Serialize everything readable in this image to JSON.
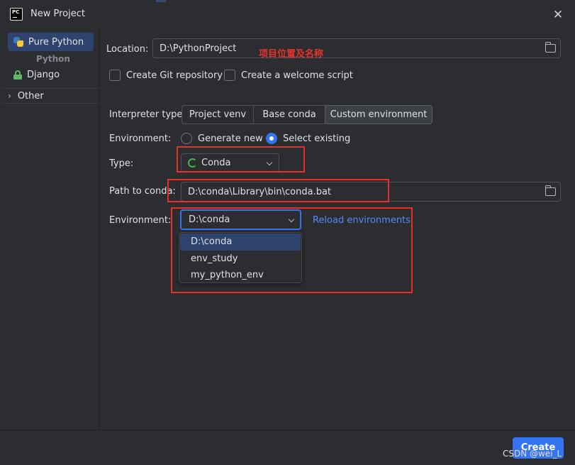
{
  "window": {
    "title": "New Project",
    "app_icon_text": "PC"
  },
  "sidebar": {
    "items": [
      {
        "label": "Pure Python",
        "icon": "python-icon"
      },
      {
        "label": "Django",
        "icon": "lock-icon"
      }
    ],
    "group_label": "Python",
    "other_label": "Other"
  },
  "form": {
    "location_label": "Location:",
    "location_value": "D:\\PythonProject",
    "annotation": "项目位置及名称",
    "git_checkbox_label": "Create Git repository",
    "welcome_checkbox_label": "Create a welcome script",
    "interpreter_label": "Interpreter type:",
    "interpreter_options": [
      "Project venv",
      "Base conda",
      "Custom environment"
    ],
    "interpreter_selected": "Custom environment",
    "environment_label": "Environment:",
    "env_radio_generate": "Generate new",
    "env_radio_select": "Select existing",
    "env_radio_selected": "Select existing",
    "type_label": "Type:",
    "type_value": "Conda",
    "path_label": "Path to conda:",
    "path_value": "D:\\conda\\Library\\bin\\conda.bat",
    "environment2_label": "Environment:",
    "environment2_value": "D:\\conda",
    "reload_link": "Reload environments",
    "env_options": [
      "D:\\conda",
      "env_study",
      "my_python_env"
    ]
  },
  "footer": {
    "create_label": "Create",
    "watermark": "CSDN @wei_L"
  },
  "colors": {
    "accent": "#3574f0",
    "annotation_red": "#e8302b",
    "link": "#548af7",
    "background": "#2b2d30"
  }
}
